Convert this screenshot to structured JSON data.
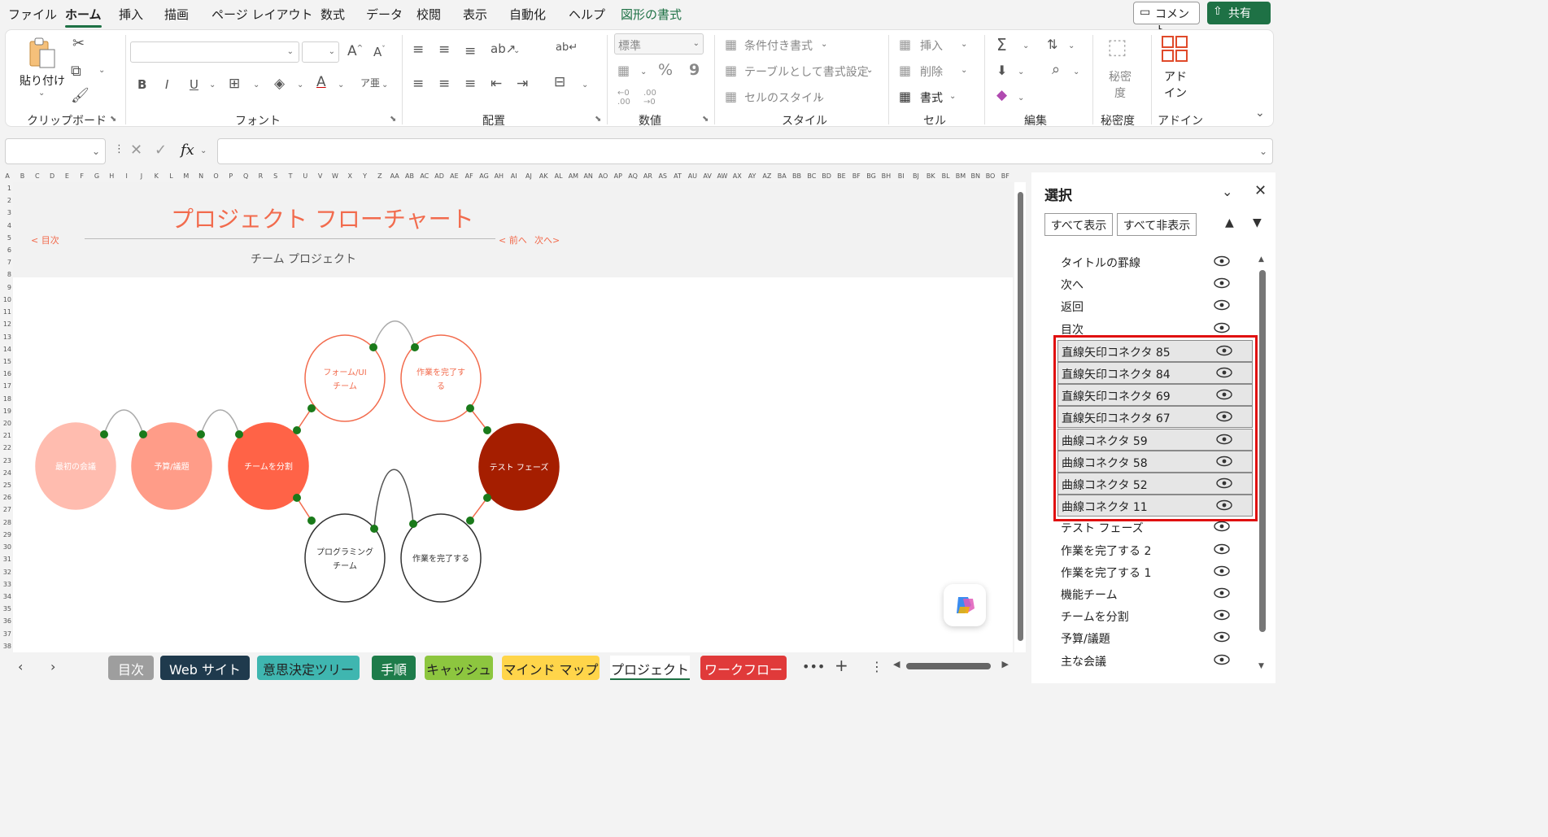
{
  "menu": {
    "items": [
      "ファイル",
      "ホーム",
      "挿入",
      "描画",
      "ページ レイアウト",
      "数式",
      "データ",
      "校閲",
      "表示",
      "自動化",
      "ヘルプ",
      "図形の書式"
    ],
    "comment_label": "コメント",
    "share_label": "共有"
  },
  "ribbon": {
    "clipboard": {
      "paste_label": "貼り付け",
      "group_label": "クリップボード"
    },
    "font": {
      "group_label": "フォント"
    },
    "alignment": {
      "group_label": "配置"
    },
    "number": {
      "format_value": "標準",
      "percent": "%",
      "comma": "9",
      "group_label": "数値"
    },
    "styles": {
      "conditional": "条件付き書式",
      "table": "テーブルとして書式設定",
      "cell_styles": "セルのスタイル",
      "group_label": "スタイル"
    },
    "cells": {
      "insert": "挿入",
      "delete": "削除",
      "format": "書式",
      "group_label": "セル"
    },
    "editing": {
      "group_label": "編集"
    },
    "sensitivity": {
      "label": "秘密度",
      "group_label": "秘密度"
    },
    "addins": {
      "label": "アドイン",
      "group_label": "アドイン"
    }
  },
  "formula_bar": {
    "name_box": "",
    "formula": ""
  },
  "columns": [
    "A",
    "B",
    "C",
    "D",
    "E",
    "F",
    "G",
    "H",
    "I",
    "J",
    "K",
    "L",
    "M",
    "N",
    "O",
    "P",
    "Q",
    "R",
    "S",
    "T",
    "U",
    "V",
    "W",
    "X",
    "Y",
    "Z",
    "AA",
    "AB",
    "AC",
    "AD",
    "AE",
    "AF",
    "AG",
    "AH",
    "AI",
    "AJ",
    "AK",
    "AL",
    "AM",
    "AN",
    "AO",
    "AP",
    "AQ",
    "AR",
    "AS",
    "AT",
    "AU",
    "AV",
    "AW",
    "AX",
    "AY",
    "AZ",
    "BA",
    "BB",
    "BC",
    "BD",
    "BE",
    "BF",
    "BG",
    "BH",
    "BI",
    "BJ",
    "BK",
    "BL",
    "BM",
    "BN",
    "BO",
    "BF"
  ],
  "rows": [
    "1",
    "2",
    "3",
    "4",
    "5",
    "6",
    "7",
    "8",
    "9",
    "10",
    "11",
    "12",
    "13",
    "14",
    "15",
    "16",
    "17",
    "18",
    "19",
    "20",
    "21",
    "22",
    "23",
    "24",
    "25",
    "26",
    "27",
    "28",
    "29",
    "30",
    "31",
    "32",
    "33",
    "34",
    "35",
    "36",
    "37",
    "38"
  ],
  "sheet": {
    "title": "プロジェクト フローチャート",
    "subtitle": "チーム プロジェクト",
    "nav_toc": "< 目次",
    "nav_prev": "< 前へ",
    "nav_next": "次へ>"
  },
  "flowchart": {
    "nodes": [
      {
        "label1": "最初の会議",
        "label2": "",
        "fill": "#ffbcaf",
        "stroke": "#ffbcaf",
        "text": "#ffffff"
      },
      {
        "label1": "予算/議題",
        "label2": "",
        "fill": "#ff9c88",
        "stroke": "#ff9c88",
        "text": "#ffffff"
      },
      {
        "label1": "チームを分割",
        "label2": "",
        "fill": "#ff6347",
        "stroke": "#ff6347",
        "text": "#ffffff"
      },
      {
        "label1": "フォーム/UI",
        "label2": "チーム",
        "fill": "#ffffff",
        "stroke": "#f26b4d",
        "text": "#f26b4d"
      },
      {
        "label1": "作業を完了す",
        "label2": "る",
        "fill": "#ffffff",
        "stroke": "#f26b4d",
        "text": "#f26b4d"
      },
      {
        "label1": "テスト フェーズ",
        "label2": "",
        "fill": "#a51e00",
        "stroke": "#a51e00",
        "text": "#ffffff"
      },
      {
        "label1": "プログラミング",
        "label2": "チーム",
        "fill": "#ffffff",
        "stroke": "#333333",
        "text": "#333333"
      },
      {
        "label1": "作業を完了する",
        "label2": "",
        "fill": "#ffffff",
        "stroke": "#333333",
        "text": "#333333"
      }
    ],
    "handle_color": "#1a7a1a"
  },
  "tabs": [
    {
      "label": "目次",
      "bg": "#9e9e9e",
      "fg": "#ffffff"
    },
    {
      "label": "Web サイト",
      "bg": "#1f3a4d",
      "fg": "#ffffff"
    },
    {
      "label": "意思決定ツリー",
      "bg": "#3fb6b0",
      "fg": "#222222"
    },
    {
      "label": "手順",
      "bg": "#1e7c4a",
      "fg": "#ffffff"
    },
    {
      "label": "キャッシュ",
      "bg": "#8dc63f",
      "fg": "#222222"
    },
    {
      "label": "マインド マップ",
      "bg": "#ffd54a",
      "fg": "#222222"
    },
    {
      "label": "プロジェクト",
      "bg": "#ffffff",
      "fg": "#222222"
    },
    {
      "label": "ワークフロー",
      "bg": "#e03a3a",
      "fg": "#ffffff"
    }
  ],
  "selection_pane": {
    "title": "選択",
    "show_all": "すべて表示",
    "hide_all": "すべて非表示",
    "items": [
      {
        "label": "タイトルの罫線",
        "selected": false
      },
      {
        "label": "次へ",
        "selected": false
      },
      {
        "label": "返回",
        "selected": false
      },
      {
        "label": "目次",
        "selected": false
      },
      {
        "label": "直線矢印コネクタ 85",
        "selected": true
      },
      {
        "label": "直線矢印コネクタ 84",
        "selected": true
      },
      {
        "label": "直線矢印コネクタ 69",
        "selected": true
      },
      {
        "label": "直線矢印コネクタ 67",
        "selected": true
      },
      {
        "label": "曲線コネクタ 59",
        "selected": true
      },
      {
        "label": "曲線コネクタ 58",
        "selected": true
      },
      {
        "label": "曲線コネクタ 52",
        "selected": true
      },
      {
        "label": "曲線コネクタ 11",
        "selected": true
      },
      {
        "label": "テスト フェーズ",
        "selected": false
      },
      {
        "label": "作業を完了する 2",
        "selected": false
      },
      {
        "label": "作業を完了する 1",
        "selected": false
      },
      {
        "label": "機能チーム",
        "selected": false
      },
      {
        "label": "チームを分割",
        "selected": false
      },
      {
        "label": "予算/議題",
        "selected": false
      },
      {
        "label": "主な会議",
        "selected": false
      }
    ]
  }
}
